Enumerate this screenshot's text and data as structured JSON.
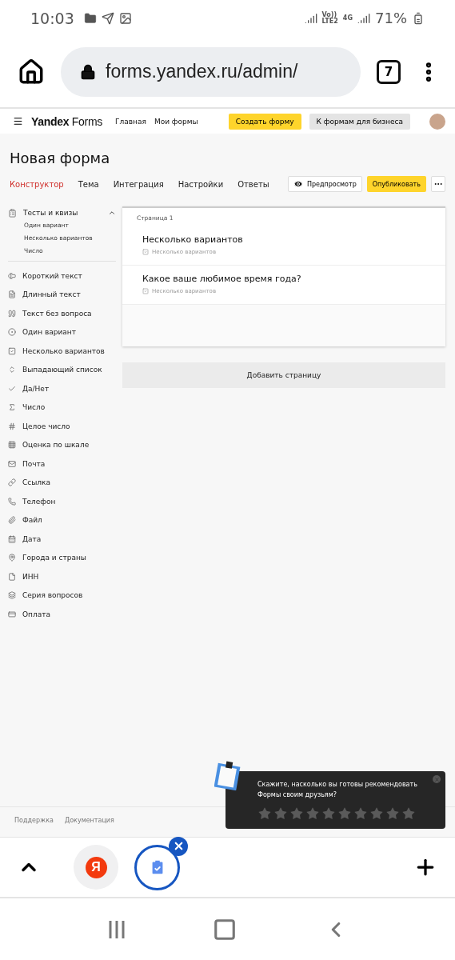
{
  "status_bar": {
    "time": "10:03",
    "volte": "Vo))",
    "lte": "LTE2",
    "network": "4G",
    "battery": "71%"
  },
  "browser": {
    "url": "forms.yandex.ru/admin/",
    "tab_count": "7"
  },
  "header": {
    "logo": "**Yandex** Forms",
    "nav": [
      "Главная",
      "Мои формы"
    ],
    "create_button": "Создать форму",
    "business_button": "К формам для бизнеса"
  },
  "form_title": "Новая форма",
  "tabs": [
    {
      "label": "Конструктор",
      "selected": true
    },
    {
      "label": "Тема",
      "selected": false
    },
    {
      "label": "Интеграция",
      "selected": false
    },
    {
      "label": "Настройки",
      "selected": false
    },
    {
      "label": "Ответы",
      "selected": false
    }
  ],
  "actions": {
    "preview": "Предпросмотр",
    "publish": "Опубликовать"
  },
  "sidebar": {
    "group": {
      "label": "Тесты и квизы",
      "expanded": true,
      "children": [
        "Один вариант",
        "Несколько вариантов",
        "Число"
      ]
    },
    "items": [
      "Короткий текст",
      "Длинный текст",
      "Текст без вопроса",
      "Один вариант",
      "Несколько вариантов",
      "Выпадающий список",
      "Да/Нет",
      "Число",
      "Целое число",
      "Оценка по шкале",
      "Почта",
      "Ссылка",
      "Телефон",
      "Файл",
      "Дата",
      "Города и страны",
      "ИНН",
      "Серия вопросов",
      "Оплата"
    ]
  },
  "page": {
    "title": "Страница 1",
    "questions": [
      {
        "title": "Несколько вариантов",
        "type": "Несколько вариантов"
      },
      {
        "title": "Какое ваше любимое время года?",
        "type": "Несколько вариантов"
      }
    ]
  },
  "add_page_button": "Добавить страницу",
  "footer": {
    "links": [
      "Поддержка",
      "Документация"
    ]
  },
  "toast": {
    "message": "Скажите, насколько вы готовы рекомендовать Формы своим друзьям?",
    "stars": 0
  },
  "tab_strip": {
    "site_logo": "Я"
  }
}
